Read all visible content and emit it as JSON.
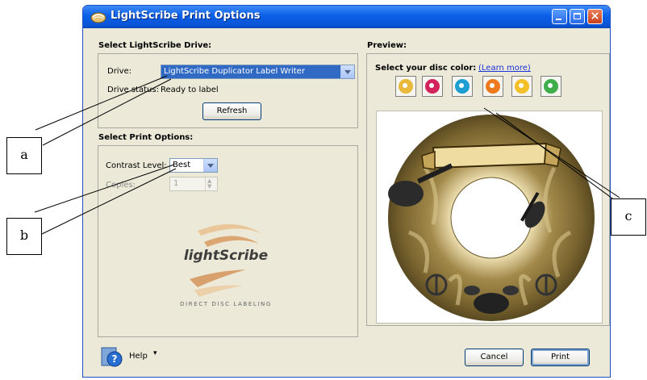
{
  "window": {
    "title": "LightScribe Print Options"
  },
  "drive_section": {
    "heading": "Select LightScribe Drive:",
    "drive_label": "Drive:",
    "drive_value": "LightScribe Duplicator Label Writer",
    "status_label": "Drive status:",
    "status_value": "Ready to label",
    "refresh_label": "Refresh"
  },
  "print_section": {
    "heading": "Select Print Options:",
    "contrast_label": "Contrast Level:",
    "contrast_value": "Best",
    "copies_label": "Copies:",
    "copies_value": "1"
  },
  "logo": {
    "name": "lightScribe",
    "tagline": "DIRECT DISC LABELING"
  },
  "preview": {
    "heading": "Preview:",
    "disc_color_label": "Select your disc color:",
    "learn_more": "(Learn more)",
    "disc_colors": [
      "#e8b93a",
      "#d2245a",
      "#1e9ed2",
      "#ee7a1e",
      "#f4c02a",
      "#3eae4a"
    ]
  },
  "footer": {
    "help_label": "Help",
    "cancel_label": "Cancel",
    "print_label": "Print"
  },
  "callouts": {
    "a": "a",
    "b": "b",
    "c": "c"
  }
}
